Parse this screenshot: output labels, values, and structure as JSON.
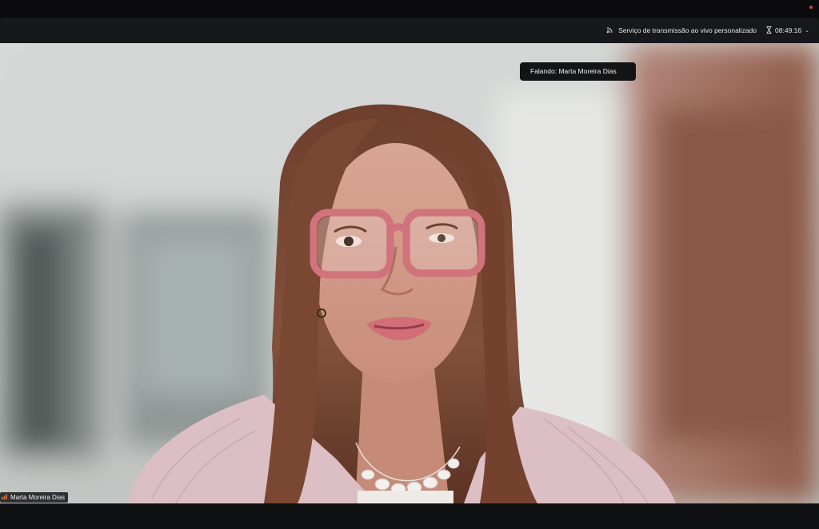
{
  "header": {
    "stream_label": "Serviço de transmissão ao vivo personalizado",
    "stream_icon": "broadcast-icon",
    "timer": "08:49:16",
    "timer_icon": "hourglass-icon"
  },
  "speaking_indicator": "Falando: Marta Moreira Dias",
  "participant": {
    "name": "Marta Moreira Dias",
    "audio_icon": "signal-bars-icon"
  },
  "colors": {
    "toolbar_bg": "#17181b",
    "window_bg": "#0d0e10",
    "badge_bg": "#131416",
    "recording_dot": "#c8473f"
  }
}
